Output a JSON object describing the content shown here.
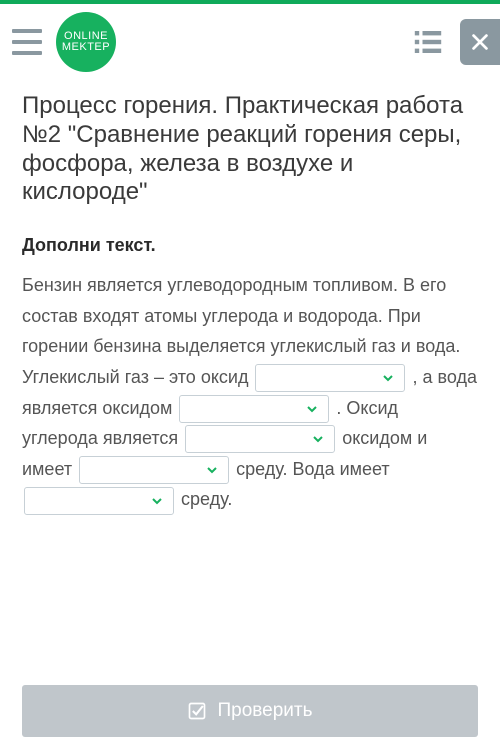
{
  "logo": {
    "line1": "ONLINE",
    "line2": "MEKTEP"
  },
  "title": "Процесс горения. Практическая работа №2 \"Сравнение реакций горения серы, фосфора, железа в воздухе и кислороде\"",
  "subtitle": "Дополни текст.",
  "paragraph": {
    "p1": "Бензин является углеводородным топливом. В его состав входят атомы углерода и водорода. При горении бензина выделяется углекислый газ и вода. Углекислый газ – это оксид ",
    "p2": " , а вода является оксидом ",
    "p3": " . Оксид углерода является ",
    "p4": " оксидом и имеет ",
    "p5": " среду. Вода имеет ",
    "p6": " среду."
  },
  "check_button": "Проверить"
}
